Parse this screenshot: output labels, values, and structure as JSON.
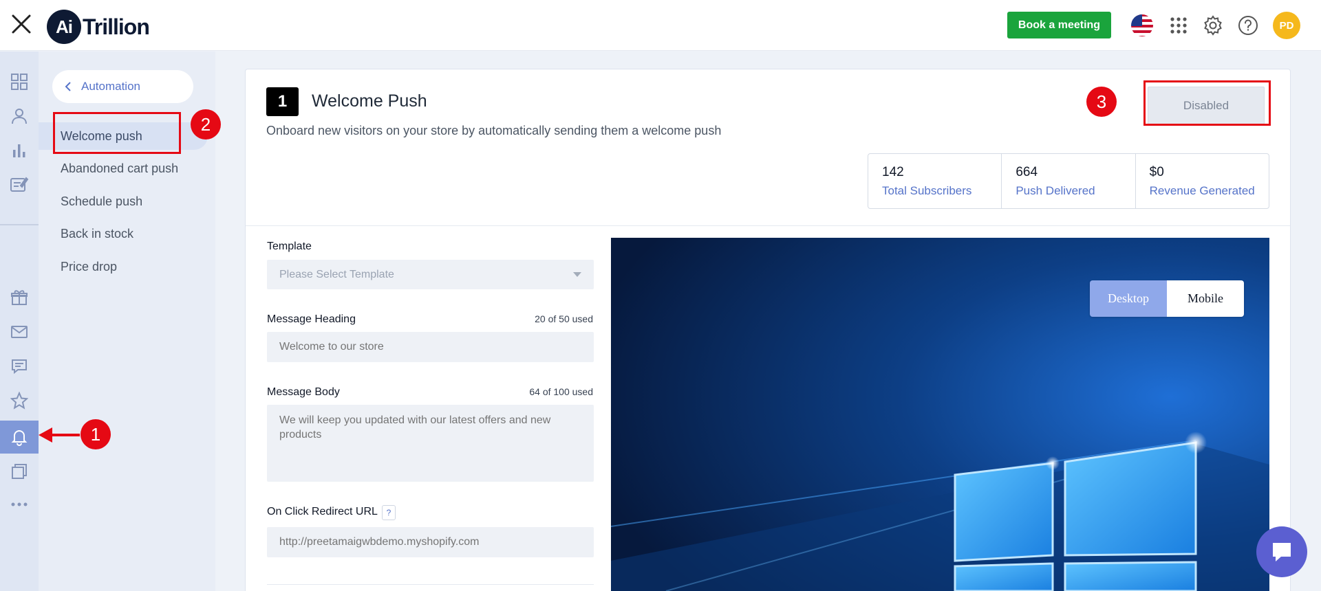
{
  "header": {
    "logo_mark": "Ai",
    "logo_text": "Trillion",
    "book_label": "Book a meeting",
    "avatar_initials": "PD",
    "icons": [
      "close-icon",
      "us-flag-icon",
      "apps-grid-icon",
      "gear-icon",
      "help-icon"
    ]
  },
  "rail": {
    "icons": [
      "dashboard-icon",
      "user-icon",
      "bar-chart-icon",
      "edit-note-icon",
      "gift-icon",
      "mail-icon",
      "chat-icon",
      "star-icon",
      "bell-icon",
      "pages-icon",
      "more-icon"
    ],
    "active": "bell-icon"
  },
  "subnav": {
    "back_label": "Automation",
    "items": [
      {
        "label": "Welcome push",
        "active": true
      },
      {
        "label": "Abandoned cart push",
        "active": false
      },
      {
        "label": "Schedule push",
        "active": false
      },
      {
        "label": "Back in stock",
        "active": false
      },
      {
        "label": "Price drop",
        "active": false
      }
    ]
  },
  "main": {
    "step": "1",
    "title": "Welcome Push",
    "subtitle": "Onboard new visitors on your store by automatically sending them a welcome push",
    "status_label": "Disabled",
    "stats": [
      {
        "value": "142",
        "label": "Total Subscribers"
      },
      {
        "value": "664",
        "label": "Push Delivered"
      },
      {
        "value": "$0",
        "label": "Revenue Generated"
      }
    ],
    "form": {
      "template_label": "Template",
      "template_placeholder": "Please Select Template",
      "heading_label": "Message Heading",
      "heading_count": "20 of 50 used",
      "heading_value": "Welcome to our store",
      "body_label": "Message Body",
      "body_count": "64 of 100 used",
      "body_value": "We will keep you updated with our latest offers and new products",
      "url_label": "On Click Redirect URL",
      "url_help": "?",
      "url_value": "http://preetamaigwbdemo.myshopify.com"
    },
    "preview": {
      "desktop_label": "Desktop",
      "mobile_label": "Mobile",
      "selected": "Desktop"
    }
  },
  "annotations": [
    "1",
    "2",
    "3"
  ],
  "colors": {
    "accent": "#5573c9",
    "book_button": "#1aa43c",
    "annotation": "#e50914",
    "avatar": "#f5b81c"
  }
}
